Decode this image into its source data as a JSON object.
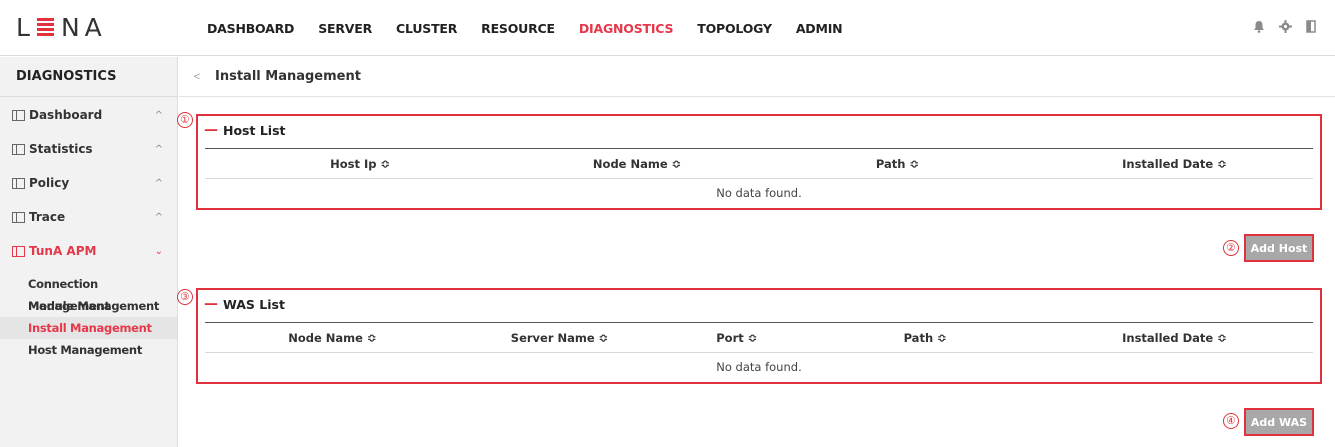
{
  "brand": {
    "logo_left": "L",
    "logo_right": "NA"
  },
  "nav": {
    "items": [
      {
        "label": "DASHBOARD",
        "active": false
      },
      {
        "label": "SERVER",
        "active": false
      },
      {
        "label": "CLUSTER",
        "active": false
      },
      {
        "label": "RESOURCE",
        "active": false
      },
      {
        "label": "DIAGNOSTICS",
        "active": true
      },
      {
        "label": "TOPOLOGY",
        "active": false
      },
      {
        "label": "ADMIN",
        "active": false
      }
    ],
    "icons": [
      "bell-icon",
      "gear-icon",
      "logout-icon"
    ]
  },
  "sidebar": {
    "title": "DIAGNOSTICS",
    "items": [
      {
        "label": "Dashboard",
        "expanded": false
      },
      {
        "label": "Statistics",
        "expanded": false
      },
      {
        "label": "Policy",
        "expanded": false
      },
      {
        "label": "Trace",
        "expanded": false
      },
      {
        "label": "TunA APM",
        "expanded": true
      }
    ],
    "subitems": [
      {
        "label": "Connection Management",
        "active": false
      },
      {
        "label": "Module Management",
        "active": false
      },
      {
        "label": "Install Management",
        "active": true
      },
      {
        "label": "Host Management",
        "active": false
      }
    ]
  },
  "page": {
    "title": "Install Management"
  },
  "markers": [
    "①",
    "②",
    "③",
    "④"
  ],
  "host_list": {
    "title": "Host List",
    "columns": [
      "Host Ip ≎",
      "Node Name ≎",
      "Path ≎",
      "Installed Date ≎"
    ],
    "empty": "No data found.",
    "add_button": "Add Host"
  },
  "was_list": {
    "title": "WAS List",
    "columns": [
      "Node Name ≎",
      "Server Name ≎",
      "Port ≎",
      "Path ≎",
      "Installed Date ≎"
    ],
    "empty": "No data found.",
    "add_button": "Add WAS"
  },
  "colors": {
    "accent": "#e5384a",
    "annotation": "#e0323c",
    "button_bg": "#a8a8a8"
  }
}
